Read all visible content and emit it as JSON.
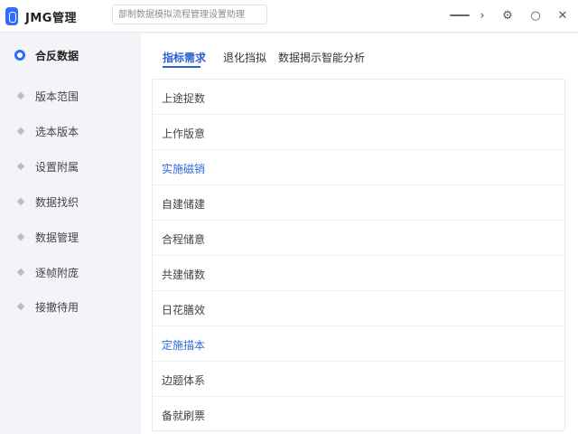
{
  "app": {
    "title": "JMG管理"
  },
  "search": {
    "placeholder": "部制数据模拟流程管理设置助理"
  },
  "window_controls": {
    "minimize": "—",
    "next": "›",
    "settings": "⚙",
    "circle": "○",
    "close": "✕"
  },
  "sidebar": {
    "items": [
      {
        "label": "合反数据",
        "active": true
      },
      {
        "label": "版本范围",
        "active": false
      },
      {
        "label": "选本版本",
        "active": false
      },
      {
        "label": "设置附属",
        "active": false
      },
      {
        "label": "数据找织",
        "active": false
      },
      {
        "label": "数据管理",
        "active": false
      },
      {
        "label": "逐帧附庞",
        "active": false
      },
      {
        "label": "接撤待用",
        "active": false
      }
    ]
  },
  "tabs": [
    {
      "label": "指标需求",
      "active": true
    },
    {
      "label": "退化挡拟",
      "active": false
    },
    {
      "label": "数据揭示智能分析",
      "active": false
    }
  ],
  "list": {
    "rows": [
      {
        "label": "上途捉数",
        "link": false
      },
      {
        "label": "上作版意",
        "link": false
      },
      {
        "label": "实施磁销",
        "link": true
      },
      {
        "label": "自建储建",
        "link": false
      },
      {
        "label": "合程储意",
        "link": false
      },
      {
        "label": "共建储数",
        "link": false
      },
      {
        "label": "日花膳效",
        "link": false
      },
      {
        "label": "定施描本",
        "link": true
      },
      {
        "label": "边题体系",
        "link": false
      },
      {
        "label": "备就刷票",
        "link": false
      }
    ]
  },
  "colors": {
    "accent": "#2f6bff",
    "link": "#2f6bd8",
    "sidebar_bg": "#f3f4f7"
  }
}
